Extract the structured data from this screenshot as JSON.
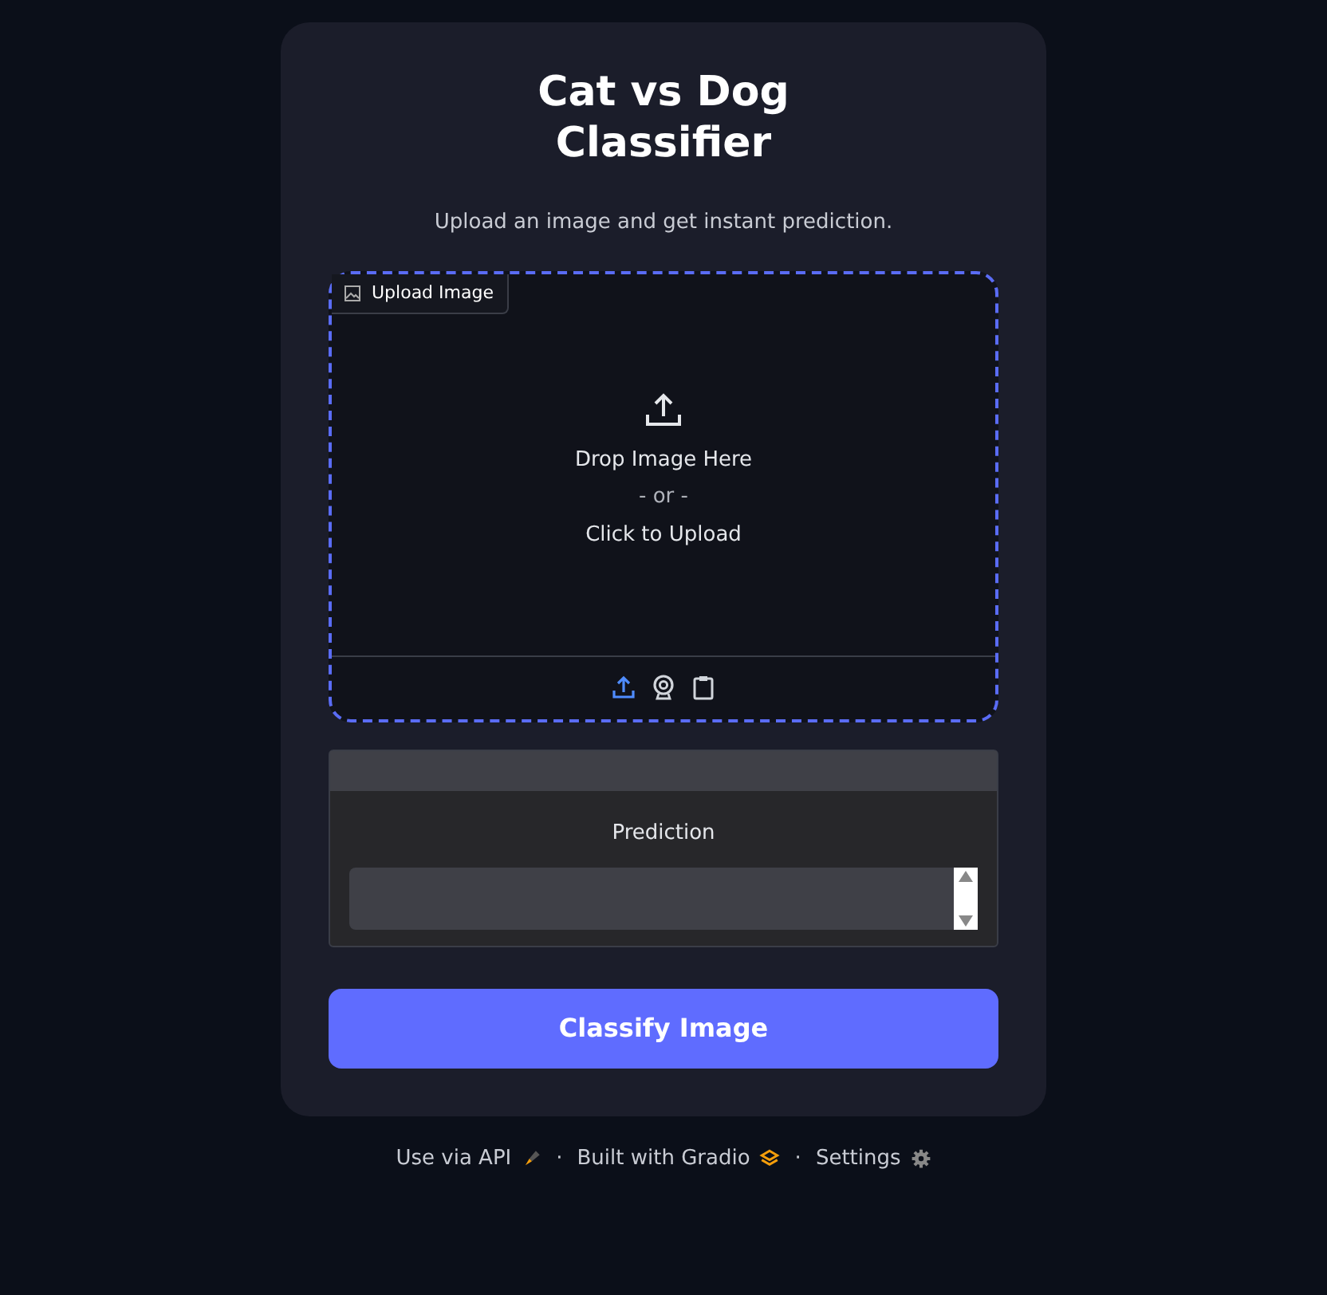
{
  "title": "Cat vs Dog Classifier",
  "description": "Upload an image and get instant prediction.",
  "upload": {
    "label": "Upload Image",
    "drop_text": "Drop Image Here",
    "or_text": "- or -",
    "click_text": "Click to Upload",
    "sources": [
      {
        "kind": "upload",
        "selected": true
      },
      {
        "kind": "webcam",
        "selected": false
      },
      {
        "kind": "clipboard",
        "selected": false
      }
    ]
  },
  "output": {
    "label": "Prediction"
  },
  "button": "Classify Image",
  "footer": [
    {
      "kind": "api",
      "label": "Use via API"
    },
    {
      "kind": "gradio",
      "label": "Built with Gradio"
    },
    {
      "kind": "settings",
      "label": "Settings"
    }
  ],
  "separator": "·"
}
